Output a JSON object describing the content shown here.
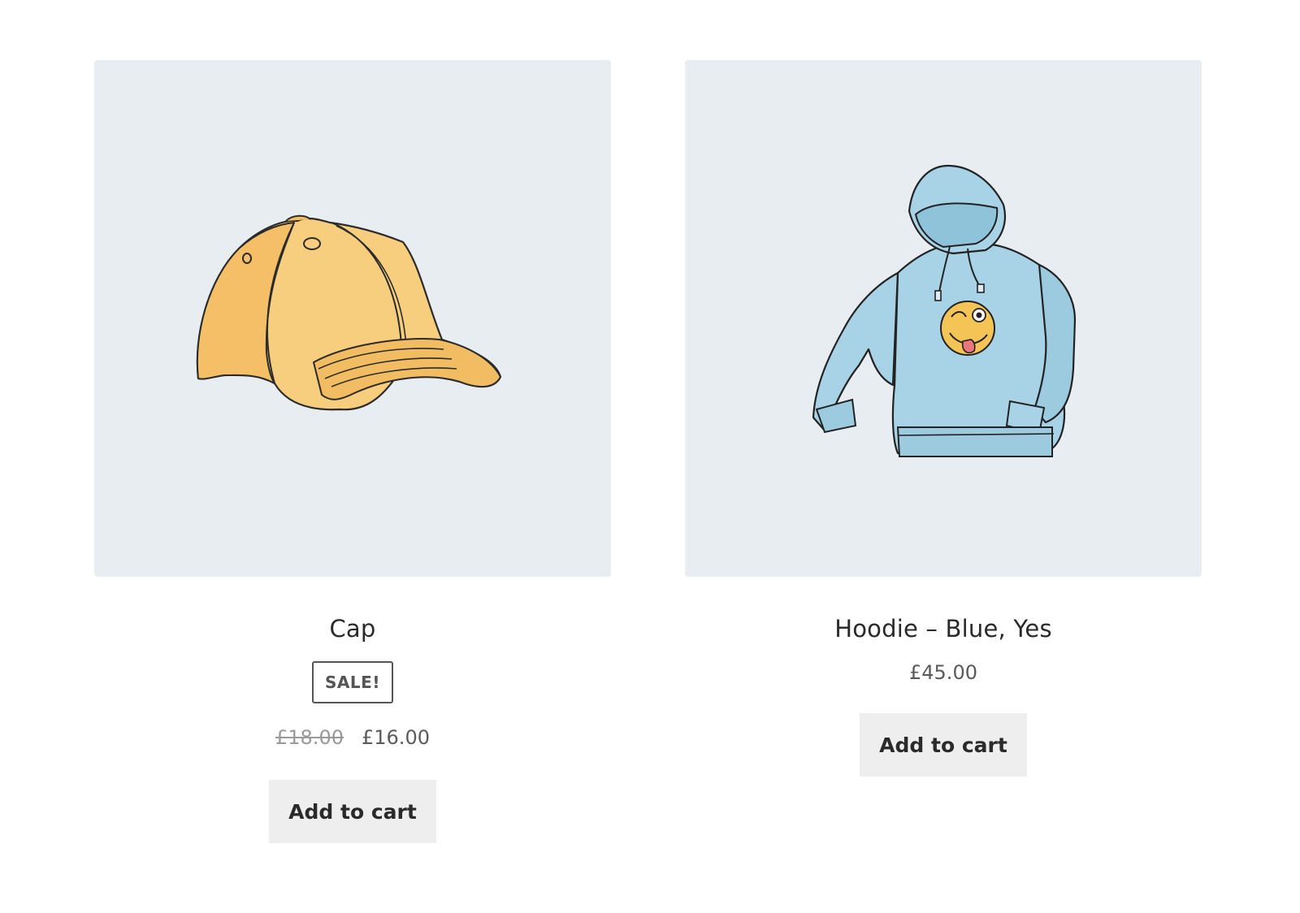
{
  "products": [
    {
      "name": "Cap",
      "sale_badge": "SALE!",
      "regular_price": "£18.00",
      "sale_price": "£16.00",
      "button_label": "Add to cart",
      "image_icon": "cap-image",
      "image_color": "#f7c873"
    },
    {
      "name": "Hoodie – Blue, Yes",
      "price": "£45.00",
      "button_label": "Add to cart",
      "image_icon": "hoodie-image",
      "image_color": "#a8d3e6"
    }
  ],
  "colors": {
    "image_background": "#e8edf2",
    "button_background": "#eeeeee",
    "text": "#2a2a2a"
  }
}
